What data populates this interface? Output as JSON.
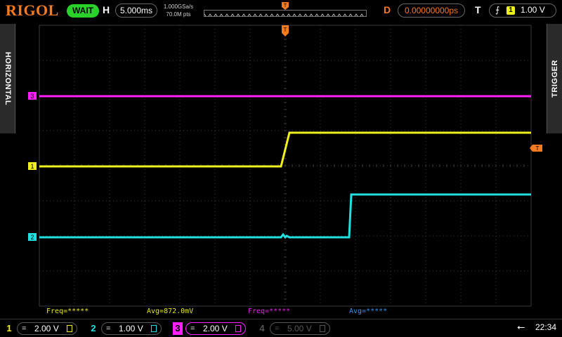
{
  "brand": "RIGOL",
  "status": "WAIT",
  "horizontal": {
    "label": "H",
    "timebase": "5.000ms",
    "sample_rate": "1.000GSa/s",
    "memory_depth": "70.0M pts"
  },
  "delay": {
    "label": "D",
    "value": "0.00000000ps"
  },
  "trigger": {
    "label": "T",
    "edge_icon": "rising-edge-icon",
    "source": "1",
    "level": "1.00 V"
  },
  "side_tabs": {
    "left": "HORIZONTAL",
    "right": "TRIGGER"
  },
  "channel_markers": {
    "ch1": "1",
    "ch2": "2",
    "ch3": "3"
  },
  "measurements": [
    {
      "text": "Freq=*****",
      "color": "#e8e820"
    },
    {
      "text": "Avg=872.0mV",
      "color": "#e8e820"
    },
    {
      "text": "Freq=*****",
      "color": "#e020e0"
    },
    {
      "text": "Avg=*****",
      "color": "#3a8fe8"
    }
  ],
  "channels": [
    {
      "num": "1",
      "coupling": "=",
      "scale": "2.00 V",
      "color": "#f0f020",
      "active": true
    },
    {
      "num": "2",
      "coupling": "=",
      "scale": "1.00 V",
      "color": "#20e0e0",
      "active": true
    },
    {
      "num": "3",
      "coupling": "=",
      "scale": "2.00 V",
      "color": "#ff20ff",
      "active": true,
      "selected": true
    },
    {
      "num": "4",
      "coupling": "=",
      "scale": "5.00 V",
      "color": "#555555",
      "active": false
    }
  ],
  "clock": "22:34",
  "colors": {
    "ch1": "#f0f020",
    "ch2": "#20e0e0",
    "ch3": "#ff20ff",
    "trigger": "#f47b20",
    "grid": "#3a3a3a"
  }
}
